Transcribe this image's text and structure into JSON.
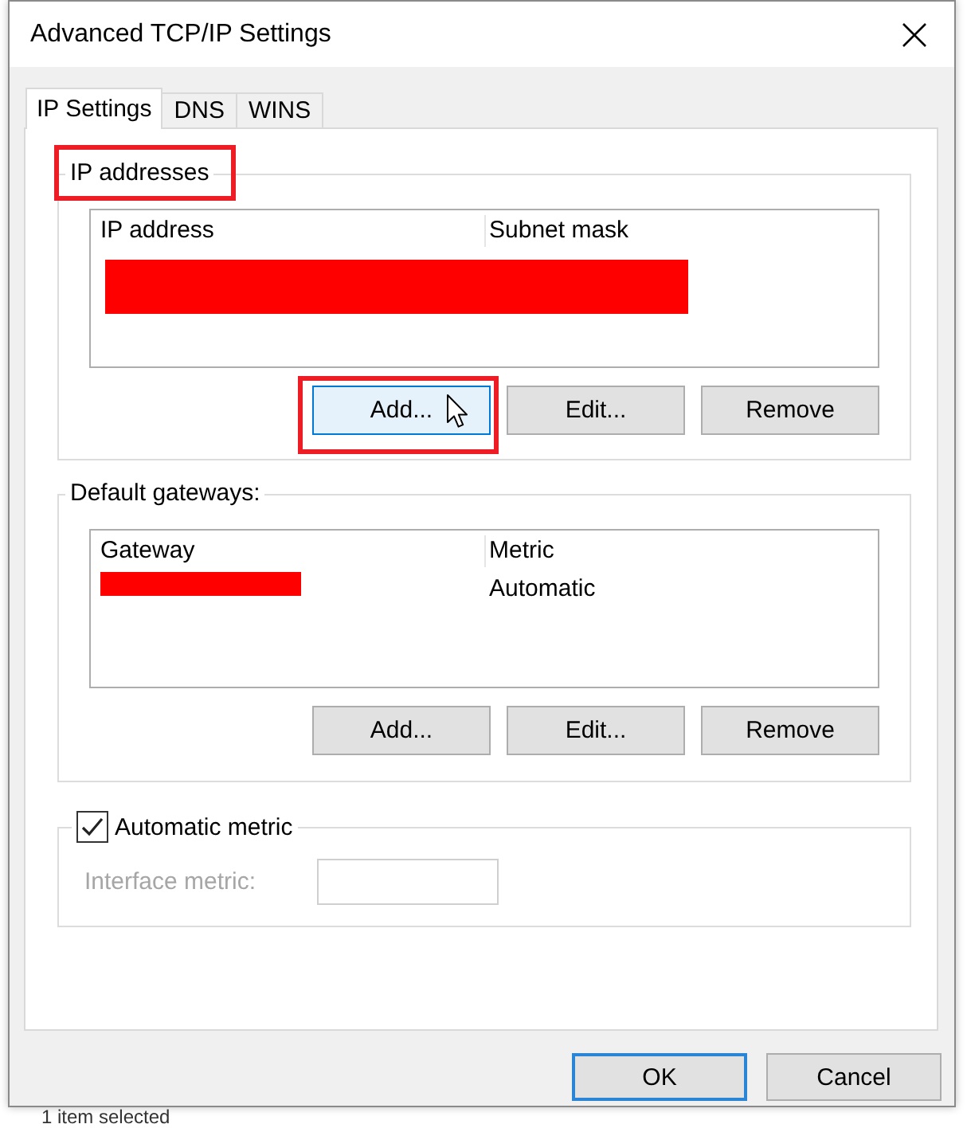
{
  "window": {
    "title": "Advanced TCP/IP Settings"
  },
  "tabs": [
    {
      "label": "IP Settings",
      "selected": true
    },
    {
      "label": "DNS",
      "selected": false
    },
    {
      "label": "WINS",
      "selected": false
    }
  ],
  "ip_addresses": {
    "label": "IP addresses",
    "highlighted": true,
    "columns": [
      "IP address",
      "Subnet mask"
    ],
    "redacted": true,
    "buttons": [
      {
        "label": "Add...",
        "hovered": true,
        "highlighted": true
      },
      {
        "label": "Edit...",
        "hovered": false,
        "highlighted": false
      },
      {
        "label": "Remove",
        "hovered": false,
        "highlighted": false
      }
    ]
  },
  "default_gateways": {
    "label": "Default gateways:",
    "columns": [
      "Gateway",
      "Metric"
    ],
    "rows": [
      {
        "gateway_redacted": true,
        "metric": "Automatic"
      }
    ],
    "buttons": [
      {
        "label": "Add...",
        "hovered": false,
        "highlighted": false
      },
      {
        "label": "Edit...",
        "hovered": false,
        "highlighted": false
      },
      {
        "label": "Remove",
        "hovered": false,
        "highlighted": false
      }
    ]
  },
  "automatic_metric": {
    "label": "Automatic metric",
    "checked": true
  },
  "interface_metric": {
    "label": "Interface metric:",
    "disabled": true
  },
  "dialog_buttons": [
    {
      "label": "OK",
      "default": true
    },
    {
      "label": "Cancel",
      "default": false
    }
  ],
  "background_window": {
    "status": "1 item selected"
  }
}
